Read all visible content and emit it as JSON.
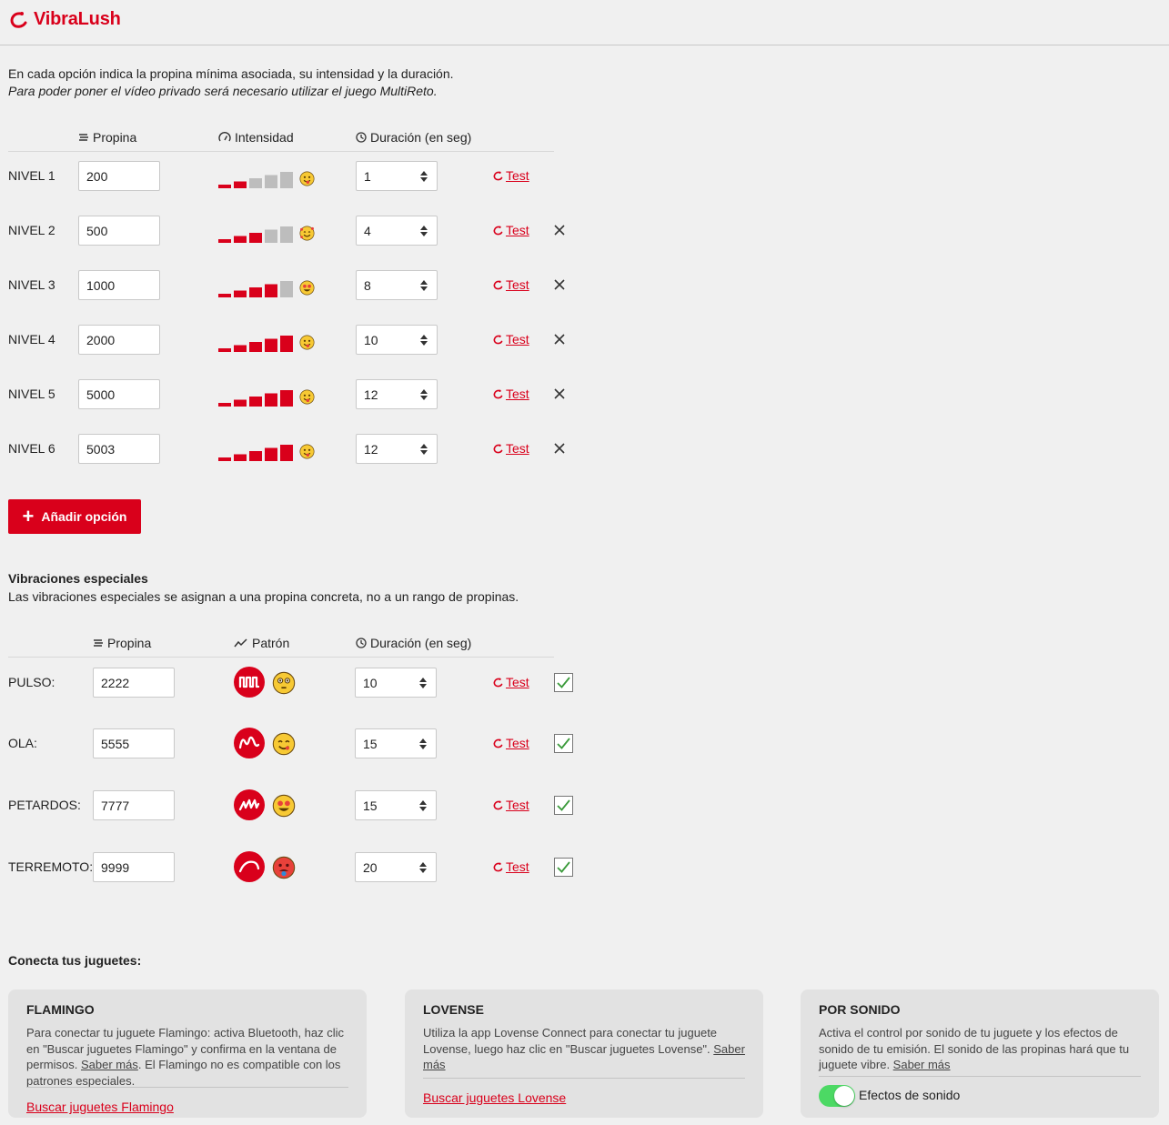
{
  "app": {
    "title": "VibraLush"
  },
  "intro": {
    "line1": "En cada opción indica la propina mínima asociada, su intensidad y la duración.",
    "line2": "Para poder poner el vídeo privado será necesario utilizar el juego MultiReto."
  },
  "levels_header": {
    "tip": "Propina",
    "intensity": "Intensidad",
    "duration": "Duración (en seg)"
  },
  "levels": [
    {
      "label": "NIVEL 1",
      "tip": "200",
      "intensity": 2,
      "duration": "1",
      "test": "Test",
      "removable": false,
      "emoji": "tongue-face"
    },
    {
      "label": "NIVEL 2",
      "tip": "500",
      "intensity": 3,
      "duration": "4",
      "test": "Test",
      "removable": true,
      "emoji": "hearts-face"
    },
    {
      "label": "NIVEL 3",
      "tip": "1000",
      "intensity": 4,
      "duration": "8",
      "test": "Test",
      "removable": true,
      "emoji": "heart-eyes-face"
    },
    {
      "label": "NIVEL 4",
      "tip": "2000",
      "intensity": 5,
      "duration": "10",
      "test": "Test",
      "removable": true,
      "emoji": "zany-face"
    },
    {
      "label": "NIVEL 5",
      "tip": "5000",
      "intensity": 5,
      "duration": "12",
      "test": "Test",
      "removable": true,
      "emoji": "zany-face"
    },
    {
      "label": "NIVEL 6",
      "tip": "5003",
      "intensity": 5,
      "duration": "12",
      "test": "Test",
      "removable": true,
      "emoji": "zany-face"
    }
  ],
  "add_button": "Añadir opción",
  "special": {
    "title": "Vibraciones especiales",
    "description": "Las vibraciones especiales se asignan a una propina concreta, no a un rango de propinas.",
    "header": {
      "tip": "Propina",
      "pattern": "Patrón",
      "duration": "Duración (en seg)"
    },
    "rows": [
      {
        "label": "PULSO:",
        "tip": "2222",
        "pattern": "pulse-pattern-icon",
        "emoji": "flushed-face",
        "duration": "10",
        "test": "Test",
        "enabled": true
      },
      {
        "label": "OLA:",
        "tip": "5555",
        "pattern": "wave-pattern-icon",
        "emoji": "yum-face",
        "duration": "15",
        "test": "Test",
        "enabled": true
      },
      {
        "label": "PETARDOS:",
        "tip": "7777",
        "pattern": "firecracker-pattern-icon",
        "emoji": "star-struck-face",
        "duration": "15",
        "test": "Test",
        "enabled": true
      },
      {
        "label": "TERREMOTO:",
        "tip": "9999",
        "pattern": "earthquake-pattern-icon",
        "emoji": "hot-face",
        "duration": "20",
        "test": "Test",
        "enabled": true
      }
    ]
  },
  "connect": {
    "title": "Conecta tus juguetes:",
    "flamingo": {
      "title": "FLAMINGO",
      "desc_a": "Para conectar tu juguete Flamingo: activa Bluetooth, haz clic en \"Buscar juguetes Flamingo\" y confirma en la ventana de permisos. ",
      "saber": "Saber más",
      "desc_b": ". El Flamingo no es compatible con los patrones especiales.",
      "link": "Buscar juguetes Flamingo"
    },
    "lovense": {
      "title": "LOVENSE",
      "desc_a": "Utiliza la app Lovense Connect para conectar tu juguete Lovense, luego haz clic en \"Buscar juguetes Lovense\". ",
      "saber": "Saber más",
      "link": "Buscar juguetes Lovense"
    },
    "sound": {
      "title": "POR SONIDO",
      "desc_a": "Activa el control por sonido de tu juguete y los efectos de sonido de tu emisión. El sonido de las propinas hará que tu juguete vibre. ",
      "saber": "Saber más",
      "toggle_label": "Efectos de sonido",
      "toggle_on": true
    }
  },
  "colors": {
    "accent": "#d9001b",
    "bar_off": "#bdbdbd",
    "toggle_on": "#4cd964",
    "check": "#3a9a3a"
  }
}
